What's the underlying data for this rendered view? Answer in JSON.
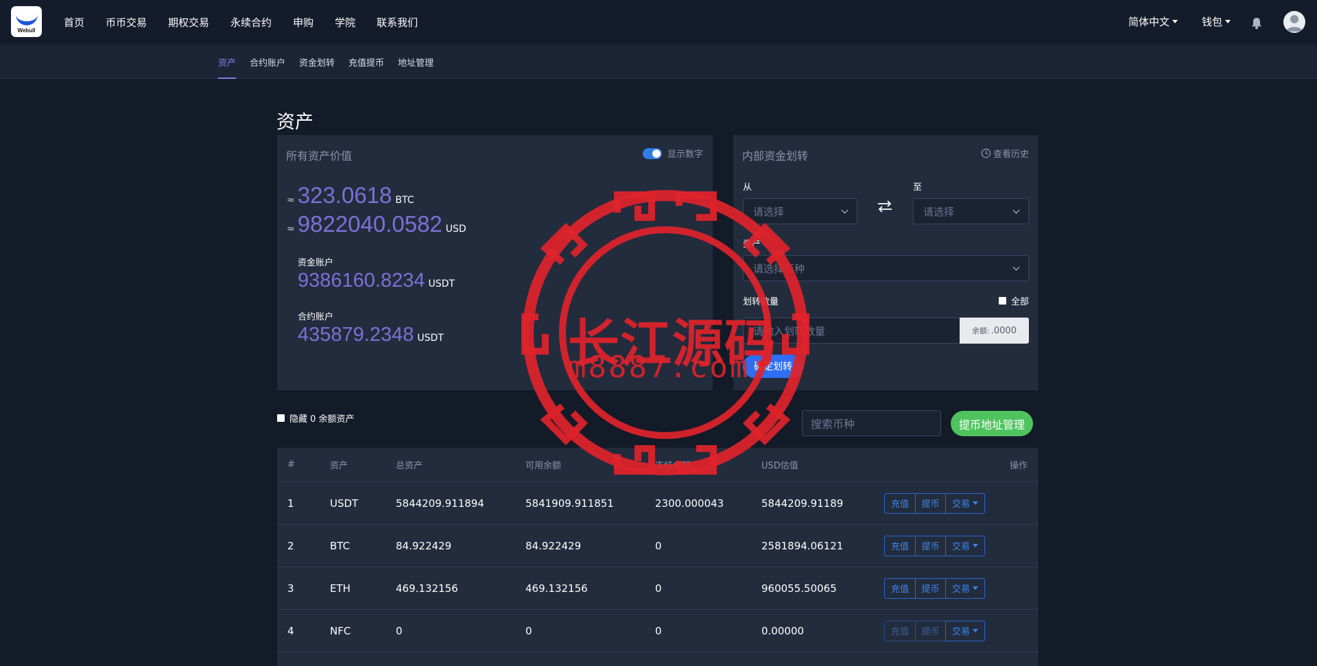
{
  "brand": {
    "logo_text": "Webull"
  },
  "nav": {
    "items": [
      "首页",
      "币币交易",
      "期权交易",
      "永续合约",
      "申购",
      "学院",
      "联系我们"
    ],
    "language": "简体中文",
    "wallet": "钱包"
  },
  "subnav": {
    "items": [
      "资产",
      "合约账户",
      "资金划转",
      "充值提币",
      "地址管理"
    ],
    "active_index": 0
  },
  "page": {
    "title": "资产"
  },
  "assets_card": {
    "heading": "所有资产价值",
    "show_numbers_label": "显示数字",
    "show_numbers_on": true,
    "approx_symbol": "≈",
    "total_btc": "323.0618",
    "btc_unit": "BTC",
    "total_usd": "9822040.0582",
    "usd_unit": "USD",
    "funding_label": "资金账户",
    "funding_value": "9386160.8234",
    "funding_unit": "USDT",
    "contract_label": "合约账户",
    "contract_value": "435879.2348",
    "contract_unit": "USDT"
  },
  "transfer_card": {
    "heading": "内部资金划转",
    "history_label": "查看历史",
    "from_label": "从",
    "to_label": "至",
    "from_placeholder": "请选择",
    "to_placeholder": "请选择",
    "asset_label": "资产",
    "asset_placeholder": "请选择币种",
    "amount_label": "划转数量",
    "all_label": "全部",
    "amount_placeholder": "请输入划转数量",
    "balance_label": "余额:",
    "balance_value": ".0000",
    "confirm_label": "确定划转"
  },
  "filters": {
    "hide_zero_label": "隐藏 0 余额资产",
    "search_placeholder": "搜索币种",
    "address_button": "提币地址管理"
  },
  "table": {
    "headers": [
      "#",
      "资产",
      "总资产",
      "可用余额",
      "冻结余额",
      "USD估值",
      "操作"
    ],
    "rows": [
      {
        "index": "1",
        "asset": "USDT",
        "total": "5844209.911894",
        "available": "5841909.911851",
        "frozen": "2300.000043",
        "usd": "5844209.91189",
        "deposit_enabled": true,
        "withdraw_enabled": true
      },
      {
        "index": "2",
        "asset": "BTC",
        "total": "84.922429",
        "available": "84.922429",
        "frozen": "0",
        "usd": "2581894.06121",
        "deposit_enabled": true,
        "withdraw_enabled": true
      },
      {
        "index": "3",
        "asset": "ETH",
        "total": "469.132156",
        "available": "469.132156",
        "frozen": "0",
        "usd": "960055.50065",
        "deposit_enabled": true,
        "withdraw_enabled": true
      },
      {
        "index": "4",
        "asset": "NFC",
        "total": "0",
        "available": "0",
        "frozen": "0",
        "usd": "0.00000",
        "deposit_enabled": false,
        "withdraw_enabled": false
      }
    ],
    "action_deposit": "充值",
    "action_withdraw": "提币",
    "action_trade": "交易"
  },
  "watermark": {
    "text": "长江源码",
    "url": "m8887.com"
  },
  "colors": {
    "accent_purple": "#7d70d6",
    "primary_blue": "#2f6ef0",
    "success_green": "#4fc45e",
    "stamp_red": "#e0232b"
  }
}
